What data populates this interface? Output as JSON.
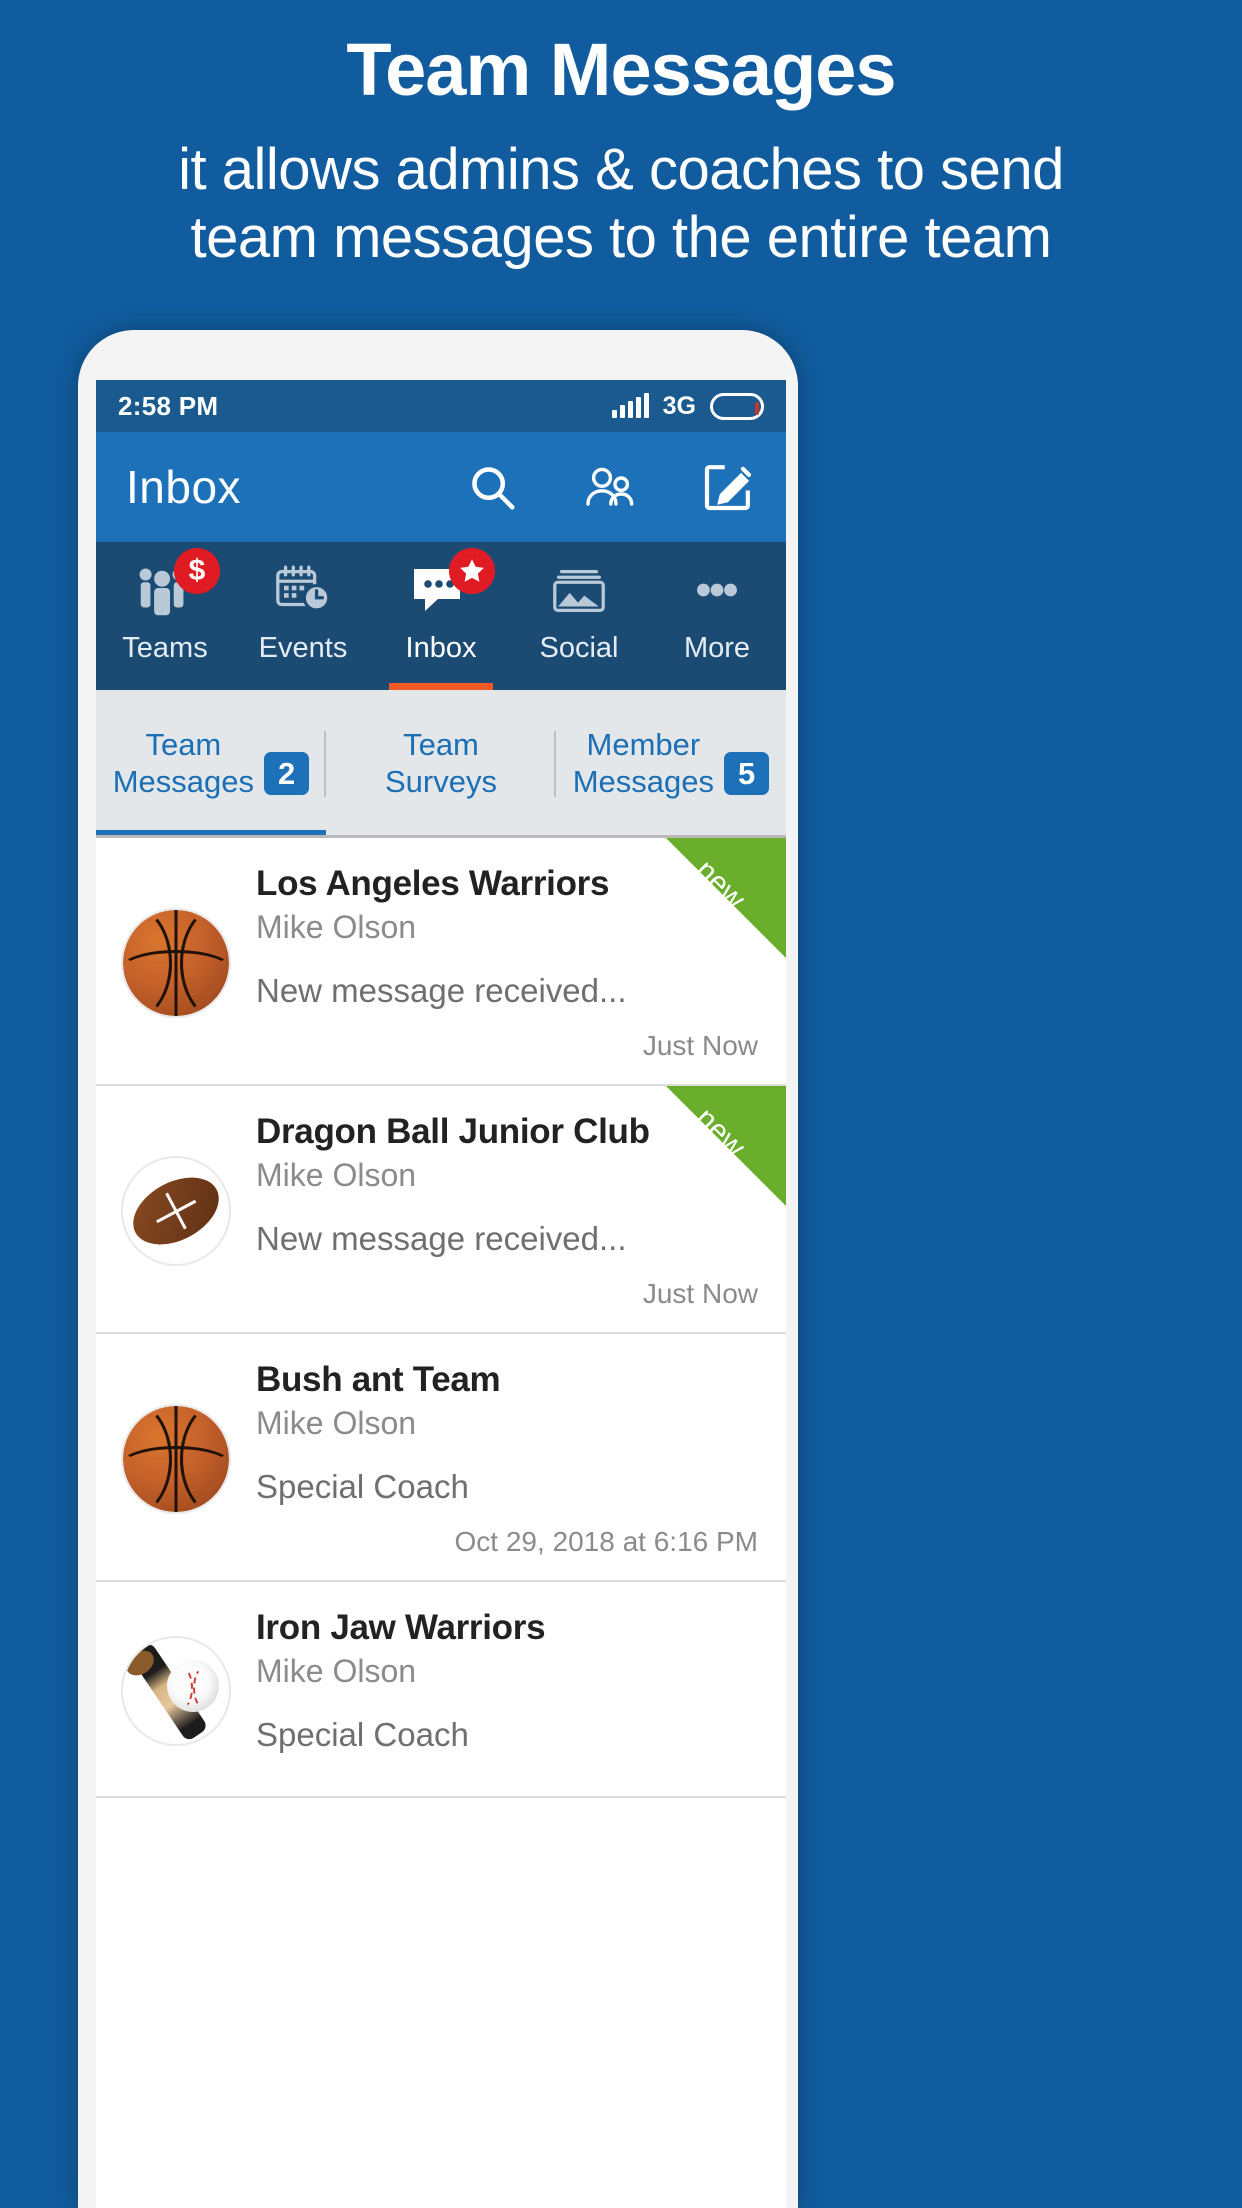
{
  "promo": {
    "title": "Team Messages",
    "subtitle": "it allows admins & coaches to send\nteam messages to the entire team"
  },
  "colors": {
    "brand_blue": "#115C9E",
    "appbar_blue": "#1D71B8",
    "statusbar_blue": "#1B5A8E",
    "nav_blue": "#1B4A73",
    "accent_orange": "#F15A24",
    "badge_red": "#E01B23",
    "ribbon_green": "#6AAE2B"
  },
  "statusbar": {
    "time": "2:58 PM",
    "network": "3G",
    "signal_icon": "signal-bars-icon",
    "battery_icon": "battery-icon"
  },
  "appbar": {
    "title": "Inbox",
    "actions": [
      {
        "name": "search-icon",
        "label": "Search"
      },
      {
        "name": "people-icon",
        "label": "Members"
      },
      {
        "name": "compose-icon",
        "label": "Compose"
      }
    ]
  },
  "mainnav": {
    "items": [
      {
        "label": "Teams",
        "icon": "people-group-icon",
        "badge": "$",
        "active": false
      },
      {
        "label": "Events",
        "icon": "calendar-clock-icon",
        "badge": "",
        "active": false
      },
      {
        "label": "Inbox",
        "icon": "chat-bubble-icon",
        "badge": "star",
        "active": true
      },
      {
        "label": "Social",
        "icon": "photo-stack-icon",
        "badge": "",
        "active": false
      },
      {
        "label": "More",
        "icon": "ellipsis-icon",
        "badge": "",
        "active": false
      }
    ]
  },
  "subtabs": {
    "items": [
      {
        "line1": "Team",
        "line2": "Messages",
        "badge": "2",
        "active": true
      },
      {
        "line1": "Team",
        "line2": "Surveys",
        "badge": "",
        "active": false
      },
      {
        "line1": "Member",
        "line2": "Messages",
        "badge": "5",
        "active": false
      }
    ]
  },
  "messages": [
    {
      "team": "Los Angeles Warriors",
      "sender": "Mike Olson",
      "preview": "New message received...",
      "time": "Just Now",
      "ribbon": "new",
      "avatar": "basketball"
    },
    {
      "team": "Dragon Ball Junior Club",
      "sender": "Mike Olson",
      "preview": "New message received...",
      "time": "Just Now",
      "ribbon": "new",
      "avatar": "football"
    },
    {
      "team": "Bush ant Team",
      "sender": "Mike Olson",
      "preview": "Special Coach",
      "time": "Oct 29, 2018 at 6:16 PM",
      "ribbon": "",
      "avatar": "basketball"
    },
    {
      "team": "Iron Jaw Warriors",
      "sender": "Mike Olson",
      "preview": "Special Coach",
      "time": "",
      "ribbon": "",
      "avatar": "baseball"
    }
  ]
}
